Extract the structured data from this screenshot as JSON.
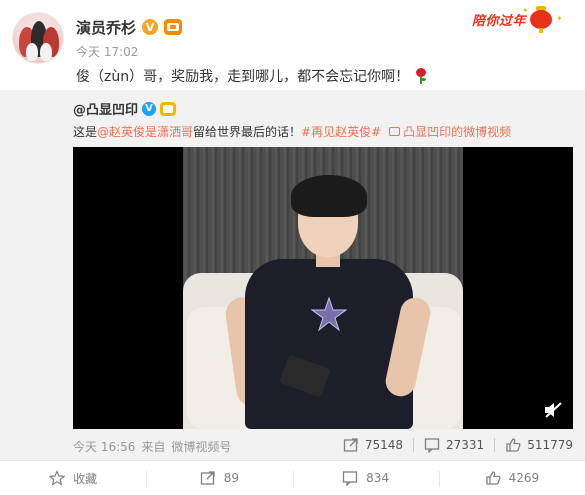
{
  "post": {
    "author_name": "演员乔杉",
    "time": "今天 17:02",
    "text": "俊（zùn）哥，奖励我，走到哪儿，都不会忘记你啊！",
    "badge_text": "陪你过年"
  },
  "repost": {
    "original_author": "@凸显凹印",
    "text_prefix": "这是",
    "mention": "@赵英俊是潇洒哥",
    "text_middle": " 留给世界最后的话！",
    "hashtag": "#再见赵英俊#",
    "video_source": "凸显凹印的微博视频",
    "meta_time": "今天 16:56",
    "meta_from": "来自",
    "meta_source": "微博视频号",
    "reposts": "75148",
    "comments": "27331",
    "likes": "511779"
  },
  "actions": {
    "favorite_label": "收藏",
    "repost_count": "89",
    "comment_count": "834",
    "like_count": "4269"
  },
  "colors": {
    "link": "#eb7350",
    "vip_blue": "#1aa3ff",
    "badge_red": "#e8331c"
  },
  "icons": [
    "verified-v-icon",
    "vip-crown-icon",
    "lantern-icon",
    "rose-emoji-icon",
    "video-source-icon",
    "mute-icon",
    "repost-icon",
    "comment-icon",
    "like-icon",
    "favorite-icon"
  ]
}
